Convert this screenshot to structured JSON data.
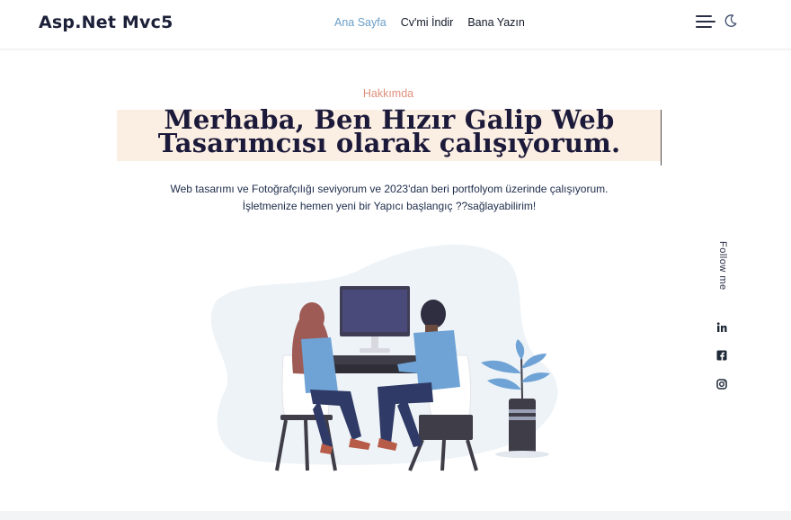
{
  "brand": {
    "title": "Asp.Net Mvc5"
  },
  "nav": {
    "items": [
      {
        "label": "Ana Sayfa",
        "active": true
      },
      {
        "label": "Cv'mi İndir",
        "active": false
      },
      {
        "label": "Bana Yazın",
        "active": false
      }
    ]
  },
  "header_icons": {
    "menu": "hamburger-icon",
    "theme": "moon-icon"
  },
  "hero": {
    "eyebrow": "Hakkımda",
    "headline_line1": "Merhaba, Ben Hızır Galip Web",
    "headline_line2": "Tasarımcısı olarak çalışıyorum.",
    "intro_line1": "Web tasarımı ve Fotoğrafçılığı seviyorum ve 2023'dan beri portfolyom üzerinde çalışıyorum.",
    "intro_line2": "İşletmenize hemen yeni bir Yapıcı başlangıç ??sağlayabilirim!"
  },
  "social": {
    "label": "Follow me",
    "icons": [
      "linkedin-icon",
      "facebook-icon",
      "instagram-icon"
    ]
  },
  "colors": {
    "accent": "#6a9ec6",
    "eyebrow": "#e0907c",
    "highlight": "#fbeee3",
    "text_dark": "#1c1a3a"
  }
}
